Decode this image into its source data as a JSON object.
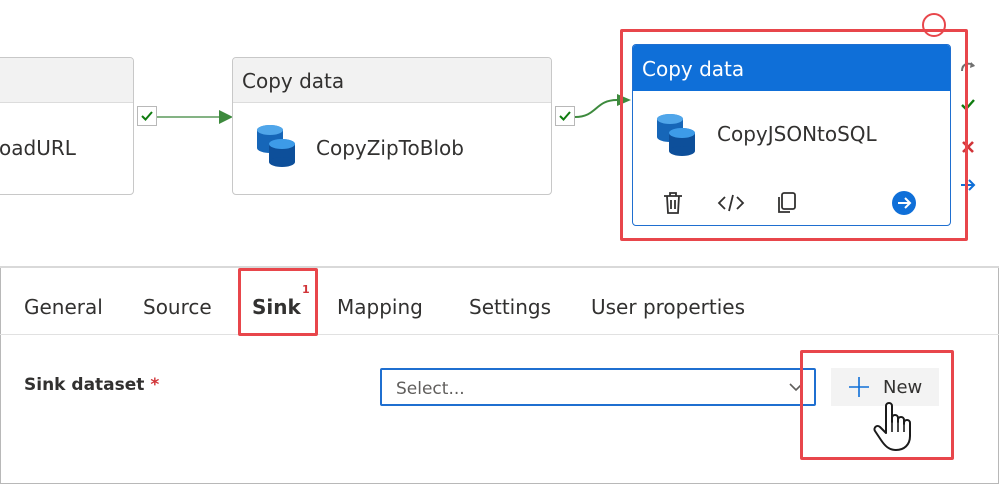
{
  "pipeline": {
    "node1": {
      "name": "oadURL"
    },
    "node2": {
      "header": "Copy data",
      "name": "CopyZipToBlob"
    },
    "node3": {
      "header": "Copy data",
      "name": "CopyJSONtoSQL"
    },
    "icons": [
      "database-icon",
      "check-icon",
      "delete-icon",
      "code-icon",
      "copy-icon",
      "arrow-right-circle-icon",
      "close-icon"
    ]
  },
  "tabs": [
    {
      "label": "General"
    },
    {
      "label": "Source"
    },
    {
      "label": "Sink",
      "badge": "1"
    },
    {
      "label": "Mapping"
    },
    {
      "label": "Settings"
    },
    {
      "label": "User properties"
    }
  ],
  "sink": {
    "label": "Sink dataset",
    "required_mark": "*",
    "placeholder": "Select...",
    "new_label": "New"
  },
  "colors": {
    "accent": "#0f6fd8",
    "highlight": "#e8464b",
    "success": "#107c10",
    "error": "#d13438"
  }
}
